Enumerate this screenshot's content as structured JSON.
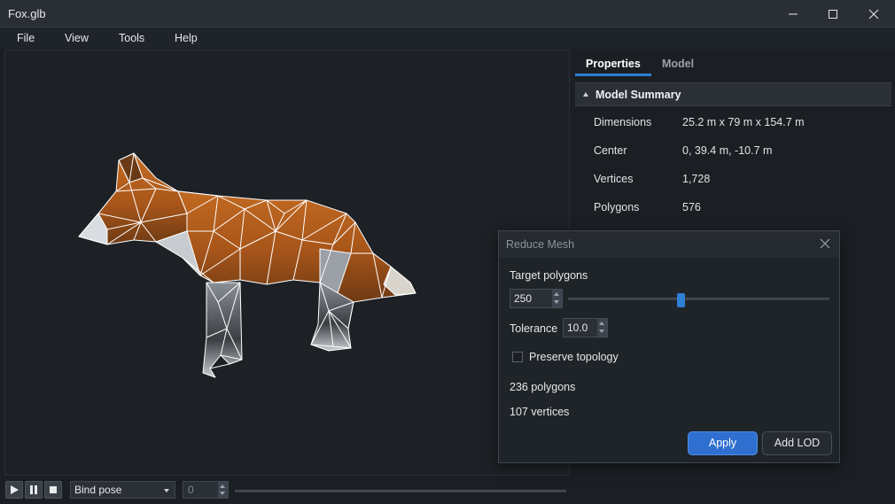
{
  "window": {
    "title": "Fox.glb"
  },
  "menu": [
    "File",
    "View",
    "Tools",
    "Help"
  ],
  "playback": {
    "pose": "Bind pose",
    "frame": "0"
  },
  "panel": {
    "tabs": [
      {
        "label": "Properties",
        "active": true
      },
      {
        "label": "Model",
        "active": false
      }
    ],
    "section_title": "Model Summary",
    "properties": [
      {
        "label": "Dimensions",
        "value": "25.2 m x 79 m x 154.7 m"
      },
      {
        "label": "Center",
        "value": "0, 39.4 m, -10.7 m"
      },
      {
        "label": "Vertices",
        "value": "1,728"
      },
      {
        "label": "Polygons",
        "value": "576"
      }
    ]
  },
  "dialog": {
    "title": "Reduce Mesh",
    "target_label": "Target polygons",
    "target_value": "250",
    "slider_fraction": 0.43,
    "tolerance_label": "Tolerance",
    "tolerance_value": "10.0",
    "preserve_label": "Preserve topology",
    "preserve_checked": false,
    "result_polygons": "236 polygons",
    "result_vertices": "107 vertices",
    "apply_label": "Apply",
    "add_lod_label": "Add LOD"
  },
  "colors": {
    "accent": "#2f7fd6",
    "viewport_bg": "#1d2126",
    "fur": "#b8621f"
  }
}
